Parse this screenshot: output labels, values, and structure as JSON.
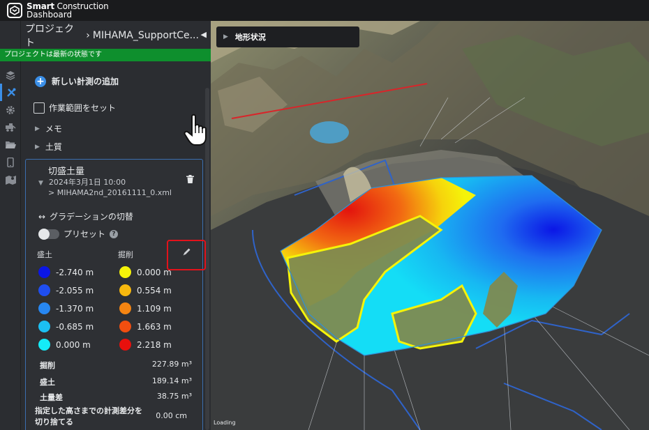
{
  "app": {
    "brand_line1_bold": "Smart",
    "brand_line1_rest": " Construction",
    "brand_line2": "Dashboard"
  },
  "header": {
    "breadcrumb_root": "プロジェクト",
    "breadcrumb_sep": "›",
    "project_name": "MIHAMA_SupportCe...",
    "dropdown_glyph": "▾",
    "collapse_glyph": "◀",
    "status": "プロジェクトは最新の状態です",
    "status_color": "#0e8f2d"
  },
  "rail": {
    "icons": [
      "layers-icon",
      "tools-icon",
      "gear-icon",
      "vehicle-icon",
      "folder-icon",
      "mobile-icon",
      "map-icon"
    ],
    "active_index": 1
  },
  "panel": {
    "add_measurement": "新しい計測の追加",
    "set_work_area": "作業範囲をセット",
    "memo": "メモ",
    "soil": "土質"
  },
  "card": {
    "title": "切盛土量",
    "date": "2024年3月1日 10:00",
    "file": "> MIHAMA2nd_20161111_0.xml",
    "gradation_toggle": "グラデーションの切替",
    "preset": "プリセット",
    "help_glyph": "?",
    "fill_header": "盛土",
    "cut_header": "掘削",
    "fill_legend": [
      {
        "color": "#0b16e6",
        "value": "-2.740 m"
      },
      {
        "color": "#1f4ef0",
        "value": "-2.055 m"
      },
      {
        "color": "#2787f2",
        "value": "-1.370 m"
      },
      {
        "color": "#1cc0f3",
        "value": "-0.685 m"
      },
      {
        "color": "#14ecf8",
        "value": "0.000 m"
      }
    ],
    "cut_legend": [
      {
        "color": "#f5f309",
        "value": "0.000 m"
      },
      {
        "color": "#f7b80e",
        "value": "0.554 m"
      },
      {
        "color": "#f58512",
        "value": "1.109 m"
      },
      {
        "color": "#f14e10",
        "value": "1.663 m"
      },
      {
        "color": "#e8100d",
        "value": "2.218 m"
      }
    ],
    "stats": [
      {
        "label": "掘削",
        "value": "227.89 m³"
      },
      {
        "label": "盛土",
        "value": "189.14 m³"
      },
      {
        "label": "土量差",
        "value": "38.75 m³"
      }
    ],
    "cutoff_label_line1": "指定した高さまでの計測差分を",
    "cutoff_label_line2": "切り捨てる",
    "cutoff_value": "0.00 cm"
  },
  "map": {
    "terrain_status": "地形状況",
    "loading": "Loading"
  }
}
